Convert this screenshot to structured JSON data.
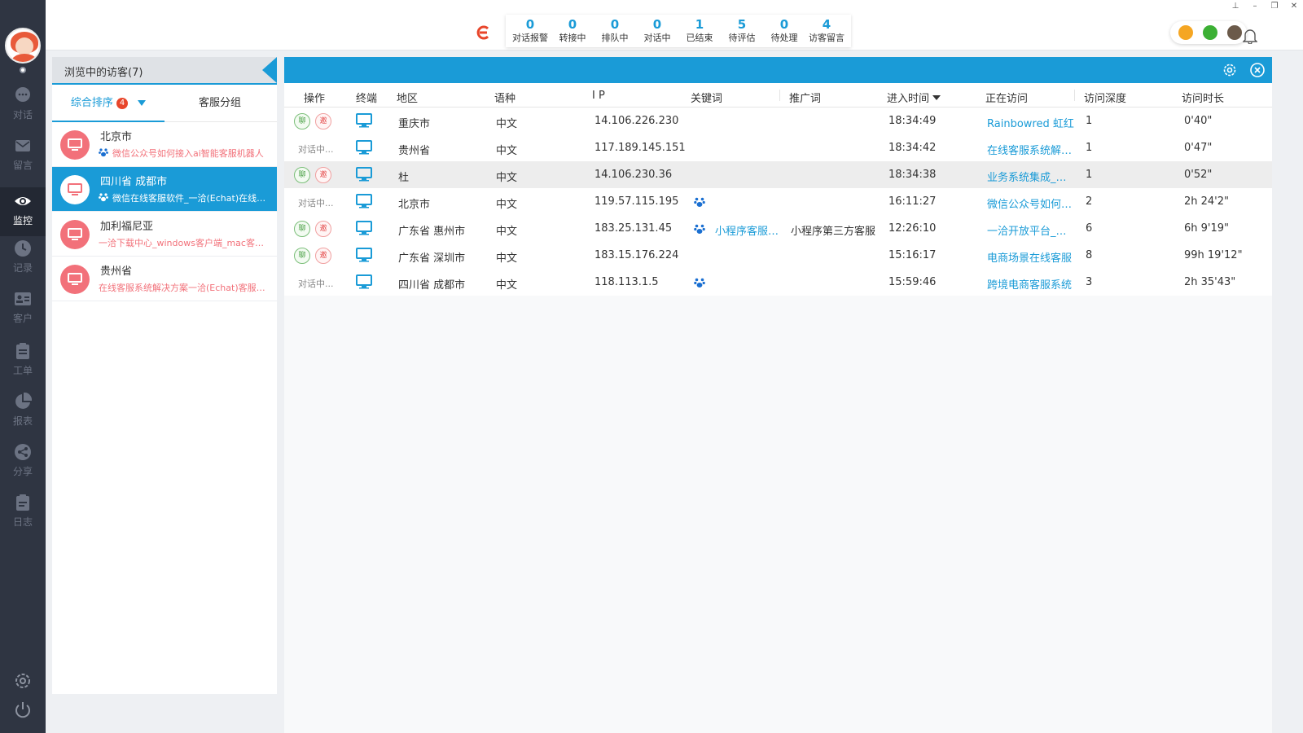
{
  "nav": {
    "items": [
      {
        "label": "对话",
        "icon": "chat-bubble-icon"
      },
      {
        "label": "留言",
        "icon": "mail-icon"
      },
      {
        "label": "监控",
        "icon": "eye-icon",
        "active": true
      },
      {
        "label": "记录",
        "icon": "clock-icon"
      },
      {
        "label": "客户",
        "icon": "contact-card-icon"
      },
      {
        "label": "工单",
        "icon": "clipboard-icon"
      },
      {
        "label": "报表",
        "icon": "pie-chart-icon"
      },
      {
        "label": "分享",
        "icon": "share-icon"
      },
      {
        "label": "日志",
        "icon": "log-icon"
      }
    ]
  },
  "stats": [
    {
      "value": "0",
      "label": "对话报警"
    },
    {
      "value": "0",
      "label": "转接中"
    },
    {
      "value": "0",
      "label": "排队中"
    },
    {
      "value": "0",
      "label": "对话中"
    },
    {
      "value": "1",
      "label": "已结束"
    },
    {
      "value": "5",
      "label": "待评估"
    },
    {
      "value": "0",
      "label": "待处理"
    },
    {
      "value": "4",
      "label": "访客留言"
    }
  ],
  "left_panel": {
    "title": "浏览中的访客(7)",
    "tab_sort": "综合排序",
    "tab_sort_badge": "4",
    "tab_group": "客服分组",
    "visitors": [
      {
        "name": "北京市",
        "page": "微信公众号如何接入ai智能客服机器人"
      },
      {
        "name": "四川省 成都市",
        "page": "微信在线客服软件_一洽(Echat)在线客服系统",
        "selected": true
      },
      {
        "name": "加利福尼亚",
        "page": "一洽下载中心_windows客户端_mac客户端"
      },
      {
        "name": "贵州省",
        "page": "在线客服系统解决方案一洽(Echat)客服系统"
      }
    ]
  },
  "table": {
    "headers": {
      "op": "操作",
      "terminal": "终端",
      "region": "地区",
      "lang": "语种",
      "ip": "I P",
      "keyword": "关键词",
      "promo": "推广词",
      "enter_time": "进入时间",
      "visiting": "正在访问",
      "depth": "访问深度",
      "duration": "访问时长"
    },
    "rows": [
      {
        "op": "buttons",
        "region": "重庆市",
        "lang": "中文",
        "ip": "14.106.226.230",
        "keyword": "",
        "promo": "",
        "time": "18:34:49",
        "page": "Rainbowred 虹红",
        "depth": "1",
        "duration": "0'40\""
      },
      {
        "op": "对话中...",
        "region": "贵州省",
        "lang": "中文",
        "ip": "117.189.145.151",
        "keyword": "",
        "promo": "",
        "time": "18:34:42",
        "page": "在线客服系统解决方案",
        "depth": "1",
        "duration": "0'47\""
      },
      {
        "op": "buttons",
        "region": "杜",
        "lang": "中文",
        "ip": "14.106.230.36",
        "keyword": "",
        "promo": "",
        "time": "18:34:38",
        "page": "业务系统集成_在线客服",
        "depth": "1",
        "duration": "0'52\"",
        "highlight": true
      },
      {
        "op": "对话中...",
        "region": "北京市",
        "lang": "中文",
        "ip": "119.57.115.195",
        "keyword": "paw",
        "promo": "",
        "time": "16:11:27",
        "page": "微信公众号如何接入",
        "depth": "2",
        "duration": "2h 24'2\""
      },
      {
        "op": "buttons",
        "region": "广东省 惠州市",
        "lang": "中文",
        "ip": "183.25.131.45",
        "keyword": "小程序客服系统",
        "promo": "小程序第三方客服",
        "time": "12:26:10",
        "page": "一洽开放平台_客服",
        "depth": "6",
        "duration": "6h 9'19\""
      },
      {
        "op": "buttons",
        "region": "广东省 深圳市",
        "lang": "中文",
        "ip": "183.15.176.224",
        "keyword": "",
        "promo": "",
        "time": "15:16:17",
        "page": "电商场景在线客服",
        "depth": "8",
        "duration": "99h 19'12\""
      },
      {
        "op": "对话中...",
        "region": "四川省 成都市",
        "lang": "中文",
        "ip": "118.113.1.5",
        "keyword": "paw",
        "promo": "",
        "time": "15:59:46",
        "page": "跨境电商客服系统",
        "depth": "3",
        "duration": "2h 35'43\""
      }
    ],
    "btn_chat": "聊",
    "btn_invite": "邀"
  },
  "colors": {
    "accent": "#1a9bd7",
    "nav_bg": "#2f3542",
    "alert": "#e8462b",
    "visitor_pink": "#f2717a"
  }
}
